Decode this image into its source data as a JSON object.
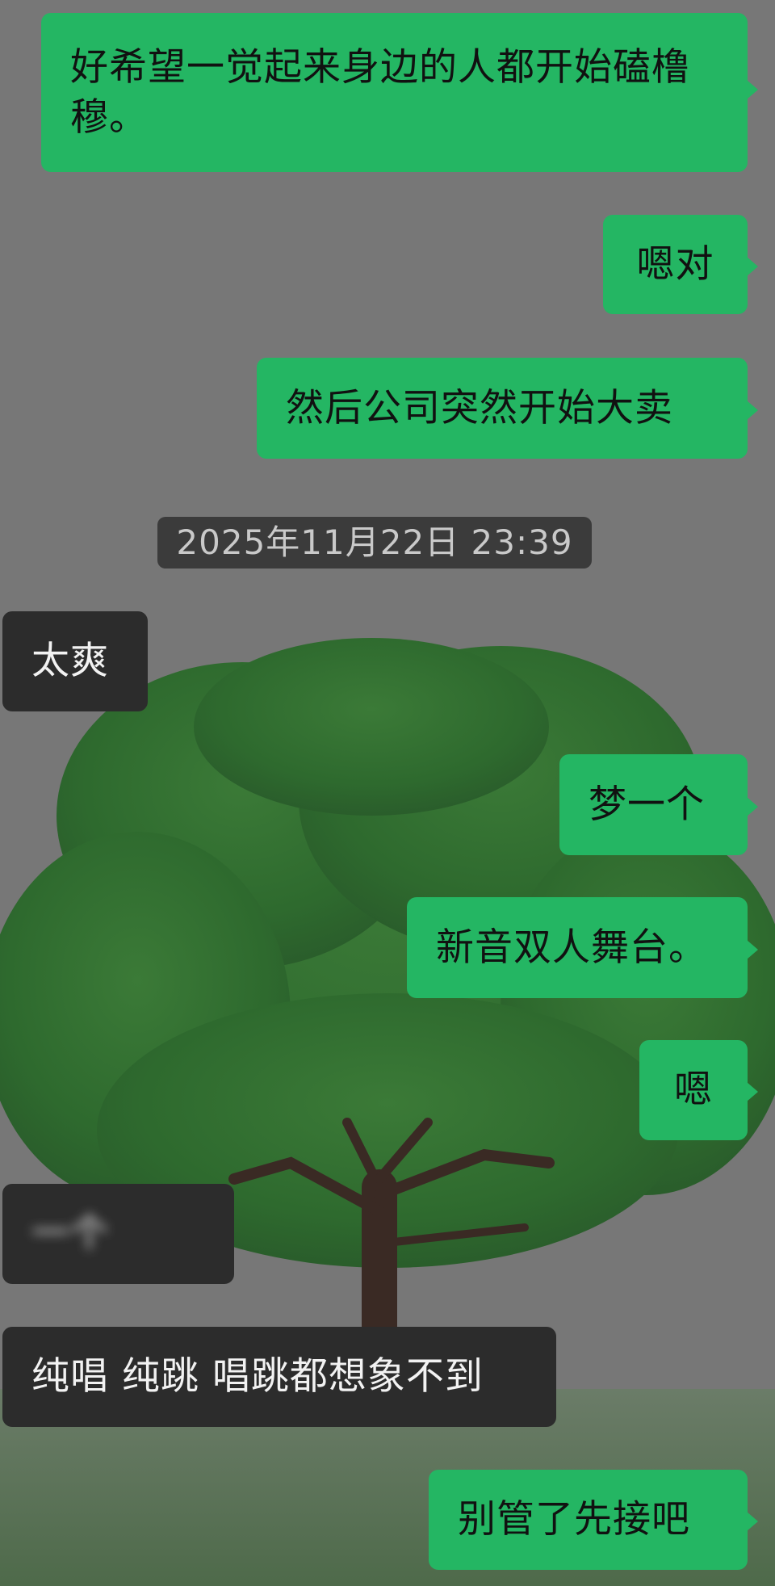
{
  "colors": {
    "outgoing_bubble": "#24b663",
    "incoming_bubble": "#2c2c2c",
    "background": "#767676",
    "tree_canopy": "#2f6e2e",
    "tree_trunk": "#3a2a24"
  },
  "messages": {
    "m1": "好希望一觉起来身边的人都开始磕橹穆。",
    "m2": "嗯对",
    "m3": "然后公司突然开始大卖",
    "timestamp": "2025年11月22日 23:39",
    "m4": "太爽",
    "m5": "梦一个",
    "m6": "新音双人舞台。",
    "m7": "嗯",
    "m8_blurred": "一个",
    "m9": "纯唱 纯跳 唱跳都想象不到",
    "m10": "别管了先接吧"
  }
}
